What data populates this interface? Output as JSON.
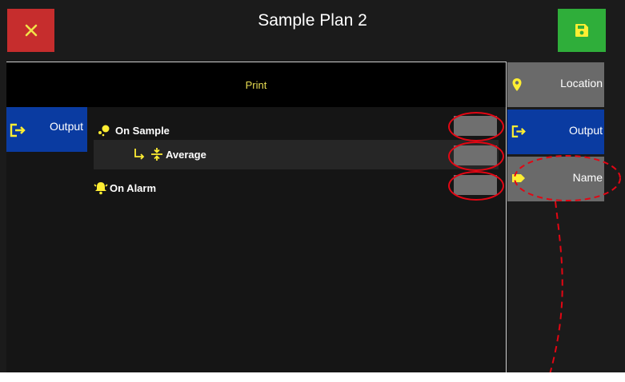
{
  "header": {
    "title": "Sample Plan 2",
    "close_icon": "close-icon",
    "save_icon": "floppy-save-icon"
  },
  "panel": {
    "section_title": "Print",
    "left_tab": {
      "label": "Output",
      "icon": "output-arrow-icon"
    },
    "rows": [
      {
        "label": "On Sample",
        "icon": "sample-dots-icon",
        "checked": false
      },
      {
        "label": "Average",
        "icon": "average-compress-icon",
        "checked": false
      },
      {
        "label": "On Alarm",
        "icon": "bell-icon",
        "checked": false
      }
    ]
  },
  "side_menu": [
    {
      "label": "Location",
      "icon": "location-pin-icon",
      "active": false
    },
    {
      "label": "Output",
      "icon": "output-arrow-icon",
      "active": true
    },
    {
      "label": "Name",
      "icon": "tag-label-icon",
      "active": false
    }
  ],
  "colors": {
    "accent_yellow": "#ffee33",
    "active_blue": "#0a3ba1",
    "close_red": "#c62d2d",
    "save_green": "#2fae3a",
    "annotation_red": "#e30613"
  }
}
